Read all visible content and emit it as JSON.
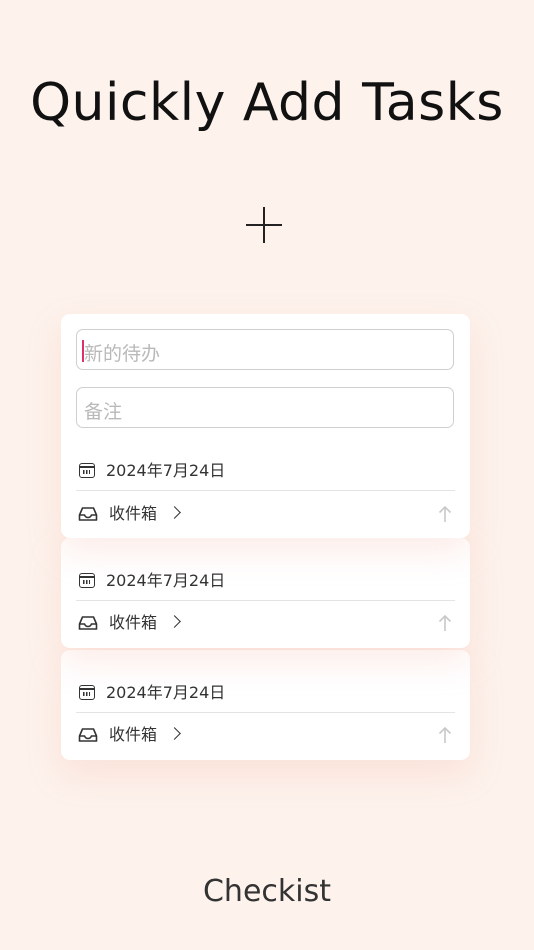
{
  "headline": "Quickly Add Tasks",
  "input": {
    "title_placeholder": "新的待办",
    "note_placeholder": "备注"
  },
  "cards": [
    {
      "date": "2024年7月24日",
      "list": "收件箱"
    },
    {
      "date": "2024年7月24日",
      "list": "收件箱"
    },
    {
      "date": "2024年7月24日",
      "list": "收件箱"
    }
  ],
  "icons": {
    "add": "plus-icon",
    "date": "calendar-icon",
    "list": "inbox-icon",
    "more": "chevron-right-icon",
    "submit": "arrow-up-icon"
  },
  "colors": {
    "background": "#fdf2ec",
    "caret": "#e0306a",
    "card": "#ffffff"
  },
  "brand": "Checkist"
}
